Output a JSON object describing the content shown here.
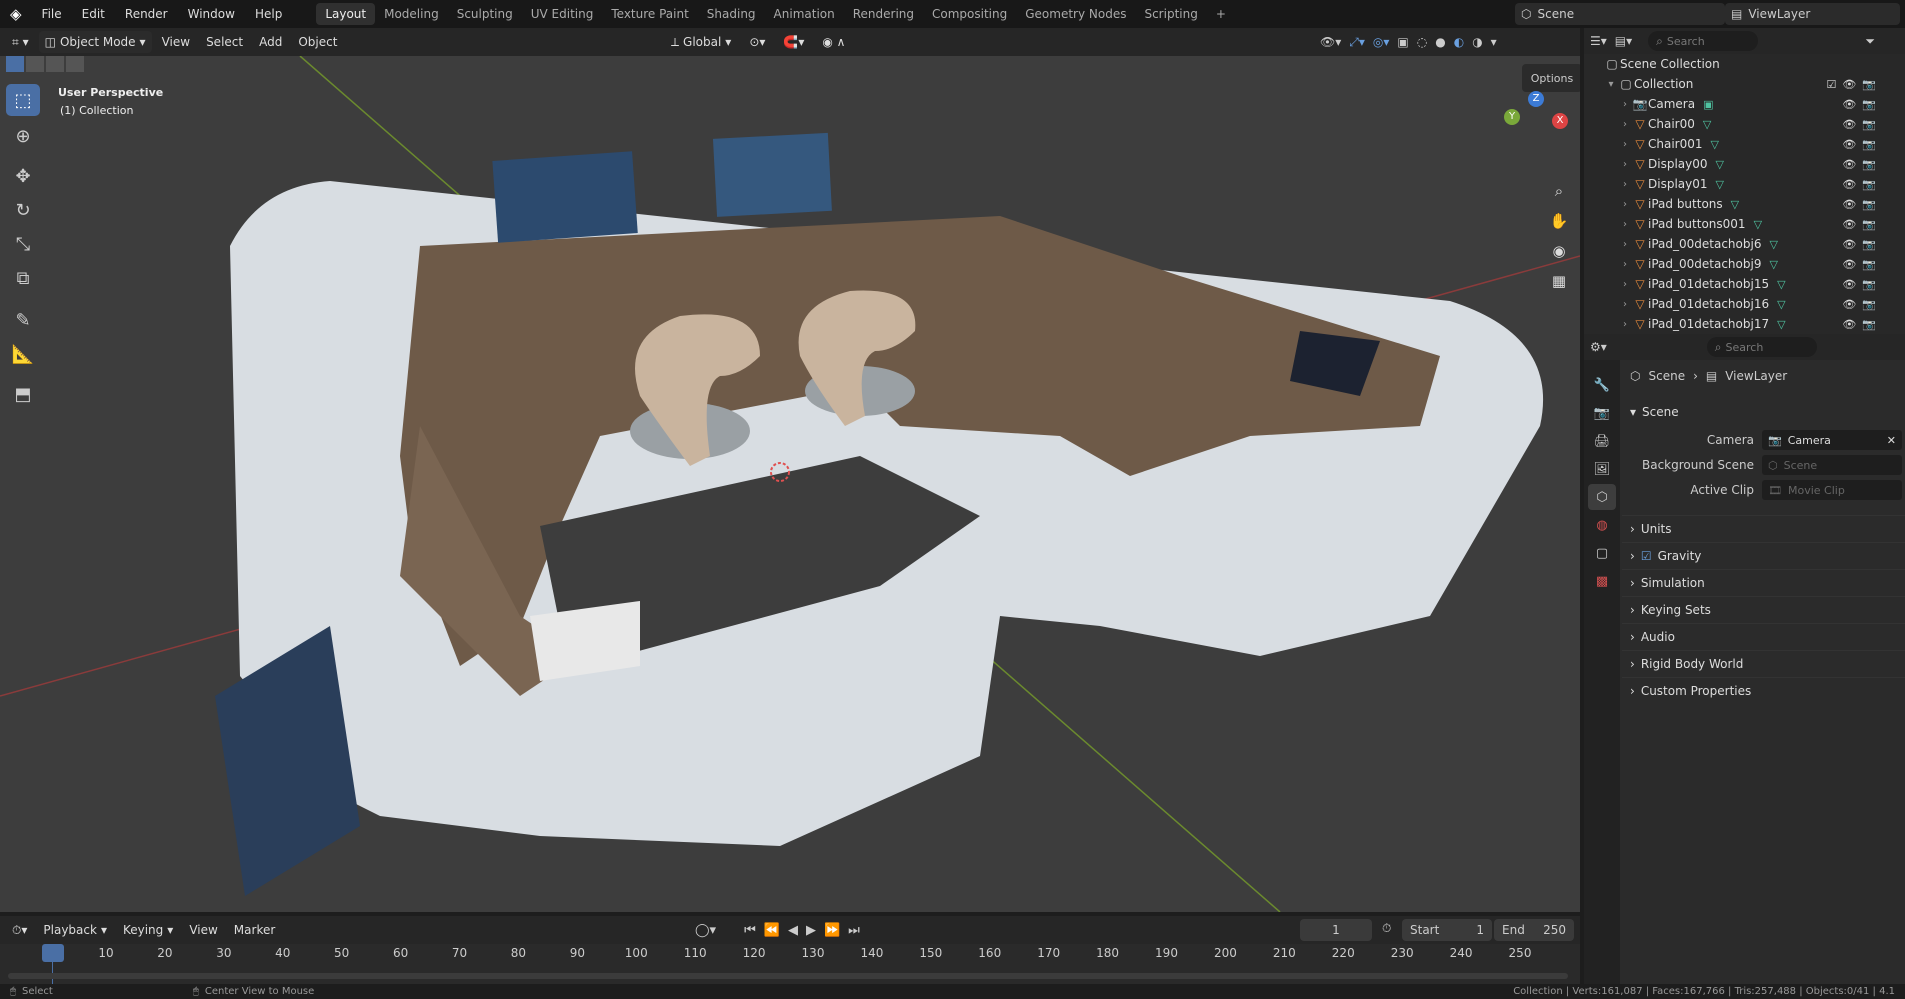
{
  "topbar": {
    "menus": [
      "File",
      "Edit",
      "Render",
      "Window",
      "Help"
    ],
    "workspaces": [
      "Layout",
      "Modeling",
      "Sculpting",
      "UV Editing",
      "Texture Paint",
      "Shading",
      "Animation",
      "Rendering",
      "Compositing",
      "Geometry Nodes",
      "Scripting"
    ],
    "active_workspace": "Layout",
    "add_tab": "+",
    "scene_name": "Scene",
    "view_layer": "ViewLayer"
  },
  "viewport_header": {
    "mode": "Object Mode",
    "menus": [
      "View",
      "Select",
      "Add",
      "Object"
    ],
    "orientation": "Global",
    "options": "Options"
  },
  "viewport": {
    "overlay_line1": "User Perspective",
    "overlay_line2": "(1) Collection",
    "gizmo": {
      "x": "X",
      "y": "Y",
      "z": "Z"
    }
  },
  "outliner": {
    "search_placeholder": "Search",
    "scene_collection": "Scene Collection",
    "collection": "Collection",
    "items": [
      "Camera",
      "Chair00",
      "Chair001",
      "Display00",
      "Display01",
      "iPad buttons",
      "iPad buttons001",
      "iPad_00detachobj6",
      "iPad_00detachobj9",
      "iPad_01detachobj15",
      "iPad_01detachobj16",
      "iPad_01detachobj17"
    ]
  },
  "properties": {
    "search_placeholder": "Search",
    "breadcrumb_scene": "Scene",
    "breadcrumb_layer": "ViewLayer",
    "panel_title": "Scene",
    "camera_label": "Camera",
    "camera_value": "Camera",
    "bg_label": "Background Scene",
    "bg_placeholder": "Scene",
    "clip_label": "Active Clip",
    "clip_placeholder": "Movie Clip",
    "sections": [
      "Units",
      "Gravity",
      "Simulation",
      "Keying Sets",
      "Audio",
      "Rigid Body World",
      "Custom Properties"
    ]
  },
  "timeline": {
    "menus": [
      "Playback",
      "Keying",
      "View",
      "Marker"
    ],
    "current_frame": "1",
    "start_label": "Start",
    "start_value": "1",
    "end_label": "End",
    "end_value": "250",
    "ticks": [
      "1",
      "10",
      "20",
      "30",
      "40",
      "50",
      "60",
      "70",
      "80",
      "90",
      "100",
      "110",
      "120",
      "130",
      "140",
      "150",
      "160",
      "170",
      "180",
      "190",
      "200",
      "210",
      "220",
      "230",
      "240",
      "250"
    ]
  },
  "statusbar": {
    "left": "Select",
    "middle": "Center View to Mouse",
    "right": "Collection | Verts:161,087 | Faces:167,766 | Tris:257,488 | Objects:0/41 | 4.1"
  },
  "colors": {
    "accent": "#4a6fa5",
    "viewport_bg": "#3d3d3d",
    "panel_bg": "#303030",
    "mesh_icon": "#4fc3a1",
    "object_icon": "#e0873b"
  }
}
